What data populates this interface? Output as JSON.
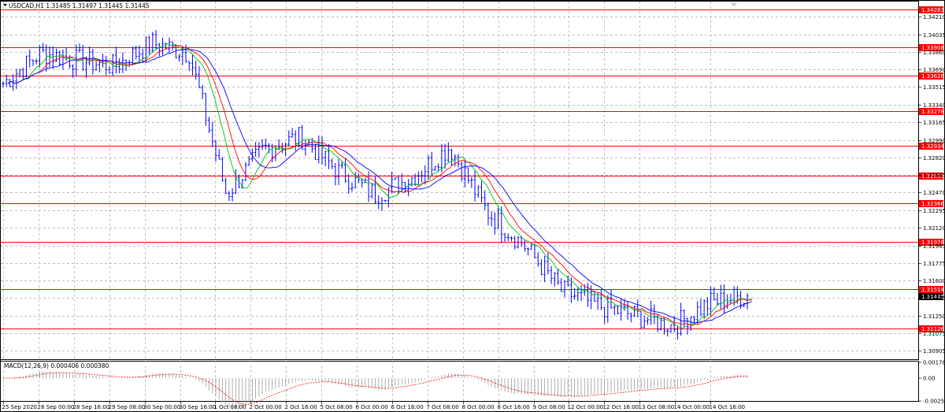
{
  "header": {
    "title": "USDCAD,H1",
    "ohlc": "1.31485 1.31497 1.31445 1.31445"
  },
  "price_axis": {
    "ticks": [
      "1.34210",
      "1.34035",
      "1.33860",
      "1.33690",
      "1.33515",
      "1.33340",
      "1.33165",
      "1.32990",
      "1.32820",
      "1.32645",
      "1.32470",
      "1.32295",
      "1.32120",
      "1.31945",
      "1.31775",
      "1.31600",
      "1.31425",
      "1.31250",
      "1.31075",
      "1.30905"
    ]
  },
  "horizontal_lines": [
    "1.34283",
    "1.33908",
    "1.33626",
    "1.33278",
    "1.32934",
    "1.32633",
    "1.32366",
    "1.31978",
    "1.31514",
    "1.31126"
  ],
  "current_price": "1.31445",
  "time_axis": {
    "labels": [
      "25 Sep 2020",
      "28 Sep 00:00",
      "28 Sep 16:00",
      "29 Sep 08:00",
      "30 Sep 00:00",
      "30 Sep 16:00",
      "1 Oct 08:00",
      "2 Oct 00:00",
      "2 Oct 16:00",
      "5 Oct 08:00",
      "6 Oct 00:00",
      "6 Oct 16:00",
      "7 Oct 08:00",
      "8 Oct 00:00",
      "8 Oct 16:00",
      "9 Oct 08:00",
      "12 Oct 00:00",
      "12 Oct 16:00",
      "13 Oct 08:00",
      "14 Oct 00:00",
      "14 Oct 16:00"
    ]
  },
  "macd": {
    "label": "MACD(12,26,9) 0.000406 0.000380",
    "ticks": [
      "0.001783",
      "0.00",
      "-0.002567"
    ]
  },
  "colors": {
    "price_bars": "#0000ff",
    "level_lines": "#ff0000",
    "ma_fast": "#00c000",
    "ma_mid": "#ff0000",
    "ma_slow": "#0000ff",
    "grid": "#a8a8a8",
    "current_price_bg": "#000000"
  },
  "chart_data": {
    "type": "line",
    "title": "USDCAD,H1",
    "x": [
      "25 Sep 2020",
      "28 Sep 00:00",
      "28 Sep 16:00",
      "29 Sep 08:00",
      "30 Sep 00:00",
      "30 Sep 16:00",
      "1 Oct 08:00",
      "2 Oct 00:00",
      "2 Oct 16:00",
      "5 Oct 08:00",
      "6 Oct 00:00",
      "6 Oct 16:00",
      "7 Oct 08:00",
      "8 Oct 00:00",
      "8 Oct 16:00",
      "9 Oct 08:00",
      "12 Oct 00:00",
      "12 Oct 16:00",
      "13 Oct 08:00",
      "14 Oct 00:00",
      "14 Oct 16:00"
    ],
    "series": [
      {
        "values": [
          1.3355,
          1.3385,
          1.3378,
          1.3372,
          1.3395,
          1.3385,
          1.3245,
          1.329,
          1.3302,
          1.3268,
          1.3245,
          1.3262,
          1.3292,
          1.3228,
          1.3195,
          1.315,
          1.3135,
          1.3125,
          1.3115,
          1.3138,
          1.3145
        ]
      }
    ],
    "ylim": [
      1.3082,
      1.3436
    ],
    "grid": true
  }
}
